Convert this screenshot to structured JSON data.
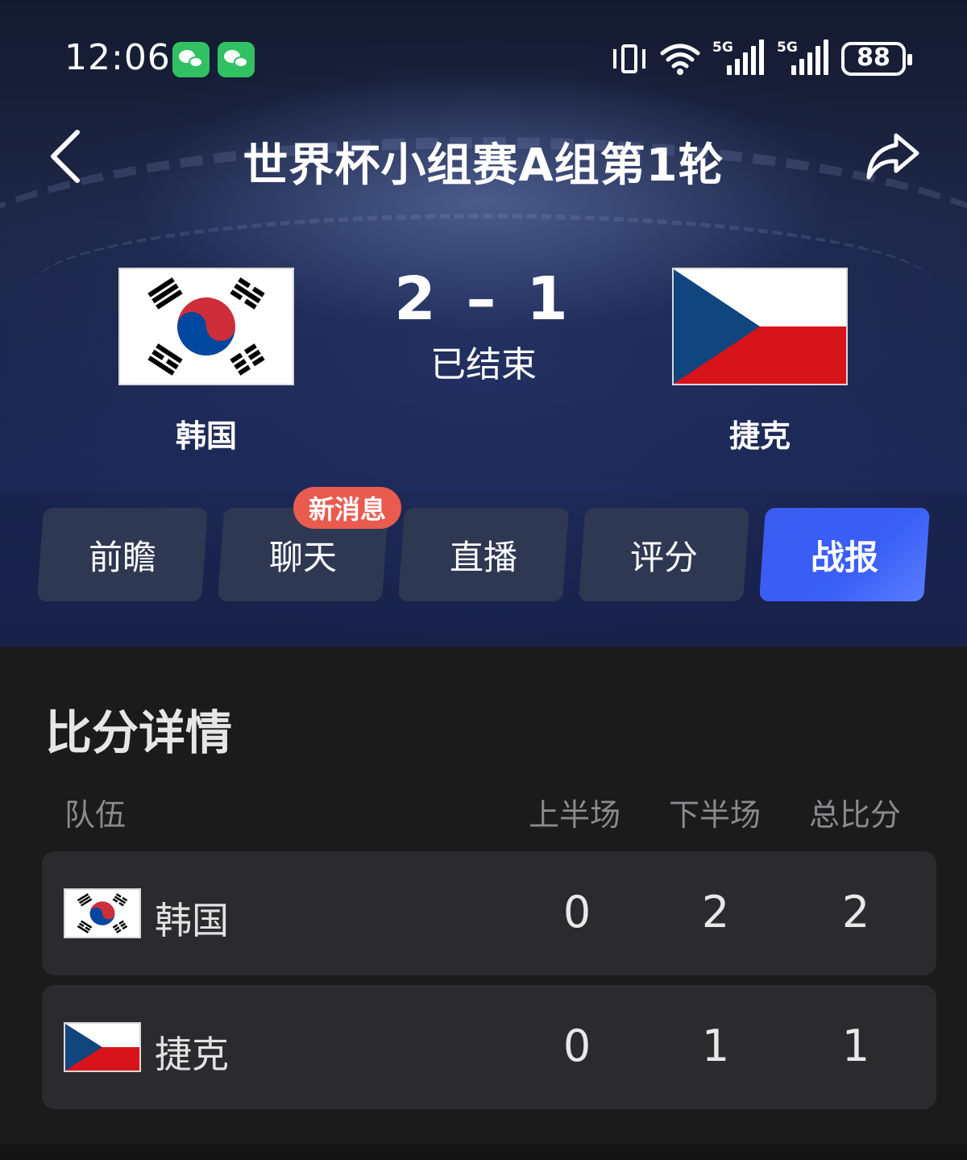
{
  "status_bar": {
    "time": "12:06",
    "battery": "88",
    "signal_labels": [
      "5G",
      "5G"
    ]
  },
  "nav": {
    "title": "世界杯小组赛A组第1轮"
  },
  "match": {
    "home": {
      "name": "韩国",
      "flag": "south-korea-flag"
    },
    "away": {
      "name": "捷克",
      "flag": "czech-flag"
    },
    "score": "2 – 1",
    "state": "已结束"
  },
  "tabs": [
    {
      "label": "前瞻",
      "active": false
    },
    {
      "label": "聊天",
      "active": false,
      "badge": "新消息"
    },
    {
      "label": "直播",
      "active": false
    },
    {
      "label": "评分",
      "active": false
    },
    {
      "label": "战报",
      "active": true
    }
  ],
  "score_detail": {
    "title": "比分详情",
    "headers": {
      "team": "队伍",
      "first_half": "上半场",
      "second_half": "下半场",
      "total": "总比分"
    },
    "rows": [
      {
        "team": "韩国",
        "first_half": "0",
        "second_half": "2",
        "total": "2"
      },
      {
        "team": "捷克",
        "first_half": "0",
        "second_half": "1",
        "total": "1"
      }
    ]
  },
  "colors": {
    "active_tab": "#3a5ff6",
    "badge": "#e95b4f",
    "tab_bg": "#2e3853",
    "page_bg": "#1b1b1c"
  }
}
